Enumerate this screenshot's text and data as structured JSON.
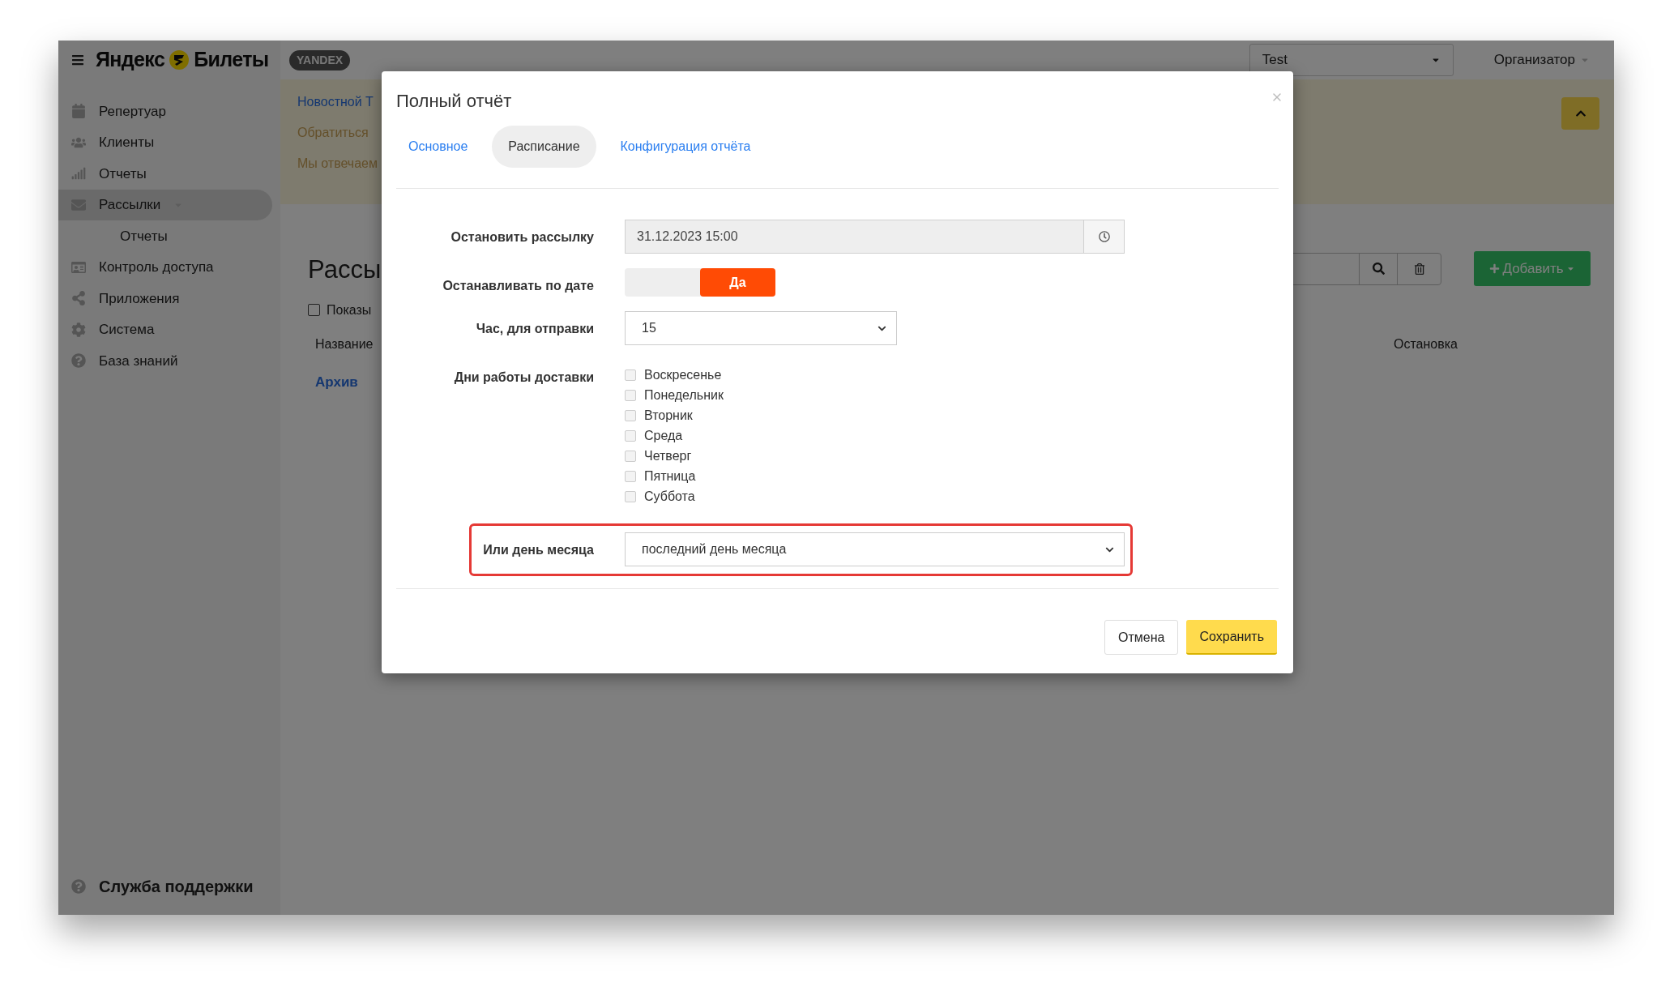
{
  "header": {
    "logo_first": "Яндекс",
    "logo_second": "Билеты",
    "badge": "YANDEX",
    "account_select": "Test",
    "role_menu": "Организатор"
  },
  "sidebar": {
    "items": [
      {
        "label": "Репертуар",
        "selected": false
      },
      {
        "label": "Клиенты",
        "selected": false
      },
      {
        "label": "Отчеты",
        "selected": false
      },
      {
        "label": "Рассылки",
        "selected": true,
        "children": [
          {
            "label": "Отчеты"
          }
        ]
      },
      {
        "label": "Контроль доступа",
        "selected": false
      },
      {
        "label": "Приложения",
        "selected": false
      },
      {
        "label": "Система",
        "selected": false
      },
      {
        "label": "База знаний",
        "selected": false
      }
    ],
    "footer_link": "Служба поддержки"
  },
  "banner": {
    "lines": [
      {
        "kind": "link",
        "text": "Новостной Т"
      },
      {
        "kind": "text",
        "text": "Обратиться"
      },
      {
        "kind": "text",
        "text": "Мы отвечаем"
      }
    ]
  },
  "page": {
    "title": "Рассы",
    "show_checkbox": {
      "label": "Показы",
      "checked": false
    },
    "columns": [
      "Название",
      "Остановка"
    ],
    "rows": [
      {
        "name": "Архив"
      }
    ],
    "add_button": "Добавить"
  },
  "modal": {
    "title": "Полный отчёт",
    "tabs": [
      {
        "label": "Основное",
        "selected": false
      },
      {
        "label": "Расписание",
        "selected": true
      },
      {
        "label": "Конфигурация отчёта",
        "selected": false
      }
    ],
    "fields": [
      {
        "kind": "datetime",
        "label": "Остановить рассылку",
        "value": "31.12.2023 15:00",
        "highlighted": false
      },
      {
        "kind": "toggle",
        "label": "Останавливать по дате",
        "on_label": "Да",
        "on": true,
        "highlighted": false
      },
      {
        "kind": "select",
        "label": "Час, для отправки",
        "value": "15",
        "highlighted": false
      },
      {
        "kind": "checklist",
        "label": "Дни работы доставки",
        "highlighted": false,
        "options": [
          {
            "label": "Воскресенье",
            "checked": false
          },
          {
            "label": "Понедельник",
            "checked": false
          },
          {
            "label": "Вторник",
            "checked": false
          },
          {
            "label": "Среда",
            "checked": false
          },
          {
            "label": "Четверг",
            "checked": false
          },
          {
            "label": "Пятница",
            "checked": false
          },
          {
            "label": "Суббота",
            "checked": false
          }
        ]
      },
      {
        "kind": "select_wide",
        "label": "Или день месяца",
        "value": "последний день месяца",
        "highlighted": true
      }
    ],
    "buttons": [
      {
        "kind": "secondary",
        "label": "Отмена"
      },
      {
        "kind": "primary",
        "label": "Сохранить"
      }
    ]
  }
}
